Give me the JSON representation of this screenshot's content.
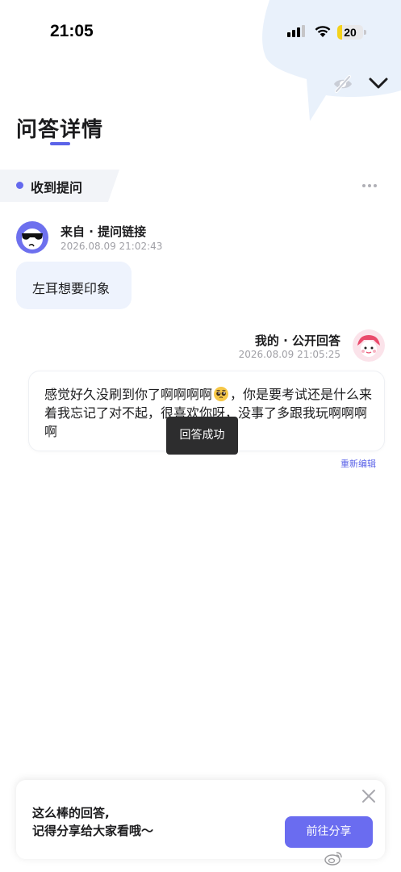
{
  "status_bar": {
    "time": "21:05",
    "battery_level": "20",
    "battery_fraction": 0.2
  },
  "header": {
    "title": "问答详情"
  },
  "section": {
    "label": "收到提问"
  },
  "question": {
    "source": "来自 · 提问链接",
    "timestamp": "2026.08.09 21:02:43",
    "text": "左耳想要印象"
  },
  "answer": {
    "author": "我的 · 公开回答",
    "timestamp": "2026.08.09 21:05:25",
    "text_before_emoji": "感觉好久没刷到你了啊啊啊啊",
    "emoji": "pleading-face",
    "text_after_emoji": "，你是要考试还是什么来着我忘记了对不起，很喜欢你呀，没事了多跟我玩啊啊啊啊",
    "re_edit_label": "重新编辑"
  },
  "toast": {
    "text": "回答成功"
  },
  "share_prompt": {
    "line_1": "这么棒的回答,",
    "line_2": "记得分享给大家看哦～",
    "button_label": "前往分享"
  },
  "colors": {
    "accent": "#6a6cf0",
    "question_bubble": "#eef3fd",
    "battery": "#f4d21b"
  },
  "icons": [
    "signal-icon",
    "wifi-icon",
    "battery-icon",
    "eye-off-icon",
    "chevron-down-icon",
    "more-icon",
    "close-icon",
    "pleading-face-emoji",
    "weibo-logo"
  ]
}
